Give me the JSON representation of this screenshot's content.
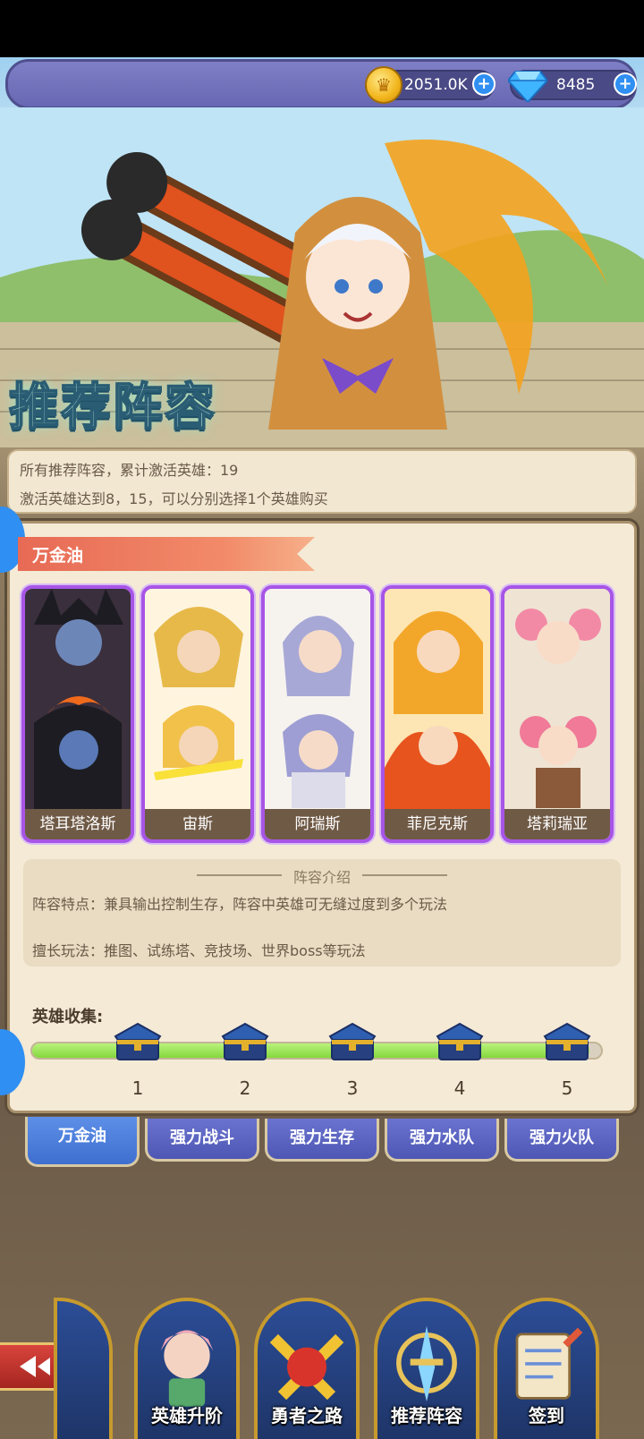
{
  "currency": {
    "coins": "2051.0K",
    "gems": "8485"
  },
  "banner": {
    "title": "推荐阵容"
  },
  "info": {
    "line1": "所有推荐阵容，累计激活英雄：19",
    "line2": "激活英雄达到8，15，可以分别选择1个英雄购买"
  },
  "lineup": {
    "name": "万金油",
    "heroes": [
      "塔耳塔洛斯",
      "宙斯",
      "阿瑞斯",
      "菲尼克斯",
      "塔莉瑞亚"
    ]
  },
  "intro": {
    "title": "阵容介绍",
    "features": "阵容特点：兼具输出控制生存，阵容中英雄可无缝过度到多个玩法",
    "modes": "擅长玩法：推图、试练塔、竞技场、世界boss等玩法"
  },
  "collection": {
    "label": "英雄收集:",
    "progress": 0.98,
    "milestones": [
      "1",
      "2",
      "3",
      "4",
      "5"
    ]
  },
  "tabs": [
    "万金油",
    "强力战斗",
    "强力生存",
    "强力水队",
    "强力火队"
  ],
  "nav": [
    "英雄升阶",
    "勇者之路",
    "推荐阵容",
    "签到"
  ],
  "colors": {
    "accent": "#a755e6",
    "tab": "#4e57b4",
    "progress": "#84d83e"
  }
}
